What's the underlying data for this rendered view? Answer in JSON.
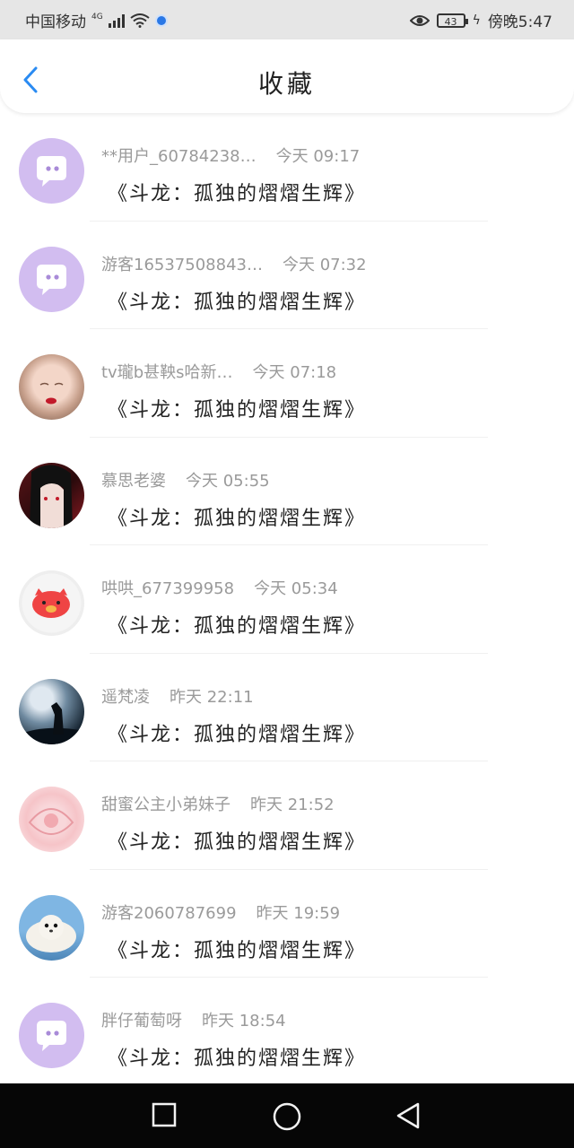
{
  "status": {
    "carrier": "中国移动",
    "net": "4G",
    "battery": "43",
    "time": "傍晚5:47"
  },
  "header": {
    "title": "收藏"
  },
  "items": [
    {
      "name": "**用户_60784238…",
      "time": "今天 09:17",
      "content": "《斗龙：孤独的熠熠生辉》",
      "avatar": "chat"
    },
    {
      "name": "游客16537508843…",
      "time": "今天 07:32",
      "content": "《斗龙：孤独的熠熠生辉》",
      "avatar": "chat"
    },
    {
      "name": "tv瓏b甚鞅s哈新…",
      "time": "今天 07:18",
      "content": "《斗龙：孤独的熠熠生辉》",
      "avatar": "face"
    },
    {
      "name": "慕思老婆",
      "time": "今天 05:55",
      "content": "《斗龙：孤独的熠熠生辉》",
      "avatar": "anime"
    },
    {
      "name": "哄哄_677399958",
      "time": "今天 05:34",
      "content": "《斗龙：孤独的熠熠生辉》",
      "avatar": "pig"
    },
    {
      "name": "遥梵凌",
      "time": "昨天 22:11",
      "content": "《斗龙：孤独的熠熠生辉》",
      "avatar": "wolf"
    },
    {
      "name": "甜蜜公主小弟妹子",
      "time": "昨天 21:52",
      "content": "《斗龙：孤独的熠熠生辉》",
      "avatar": "pink"
    },
    {
      "name": "游客2060787699",
      "time": "昨天 19:59",
      "content": "《斗龙：孤独的熠熠生辉》",
      "avatar": "seal"
    },
    {
      "name": "胖仔葡萄呀",
      "time": "昨天 18:54",
      "content": "《斗龙：孤独的熠熠生辉》",
      "avatar": "chat"
    }
  ],
  "nav": {
    "recent_icon": "square-icon",
    "home_icon": "circle-icon",
    "back_icon": "triangle-back-icon"
  }
}
